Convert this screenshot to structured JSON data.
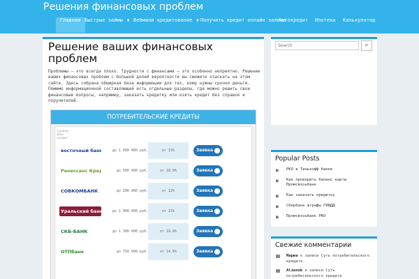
{
  "header": {
    "site_title": "Решения финансовых проблем"
  },
  "nav": {
    "items": [
      {
        "label": "Главная",
        "active": true
      },
      {
        "label": "Быстрые займы",
        "dropdown": true
      },
      {
        "label": "Вебмани кредитование",
        "dropdown": true
      },
      {
        "label": "Получить кредит онлайн заявка"
      },
      {
        "label": "Автокредит"
      },
      {
        "label": "Ипотека"
      },
      {
        "label": "Калькулятор"
      }
    ]
  },
  "main": {
    "title": "Решение ваших финансовых проблем",
    "intro": "Проблемы – это всегда плохо. Трудности с финансами – это особенно неприятно. Решение ваших финансовых проблем с большой долей вероятности вы сможете отыскать на этом сайте. Здесь собрана обширная база информации для тех, кому нужны срочно деньги. Помимо информационной составляющей есть отдельные разделы, где можно решить свои финансовые вопросы, например, заказать кредитку или взять кредит без справок и поручителей.",
    "widget": {
      "title": "ПОТРЕБИТЕЛЬСКИЕ КРЕДИТЫ",
      "logo_text": "Сравни Ваш кредит",
      "rows": [
        {
          "bank": "восточный банк",
          "color": "#1a3d7c",
          "bg": "#ffffff",
          "amount": "до 1 000 000 руб.",
          "rate": "от 15%",
          "button": "Заявка"
        },
        {
          "bank": "Ренессанс Кредит",
          "color": "#6a9a2a",
          "bg": "#ffffff",
          "amount": "до 500 000 руб.",
          "rate": "от 18.9%",
          "button": "Заявка"
        },
        {
          "bank": "СОВКОМБАНК",
          "color": "#1a3d8c",
          "bg": "#ffffff",
          "amount": "до 200 000 руб.",
          "rate": "от 12%",
          "button": "Заявка"
        },
        {
          "bank": "Уральский банк",
          "color": "#ffffff",
          "bg": "#8b1c3a",
          "amount": "до 1 000 000 руб.",
          "rate": "от 15%",
          "button": "Заявка"
        },
        {
          "bank": "СКБ-БАНК",
          "color": "#1f7a3a",
          "bg": "#ffffff",
          "amount": "до 1 300 000 руб.",
          "rate": "от 19.9%",
          "button": "Заявка"
        },
        {
          "bank": "ОТПбанк",
          "color": "#2e8b2e",
          "bg": "#ffffff",
          "amount": "до 750 000 руб.",
          "rate": "от 14.9%",
          "button": "Заявка"
        }
      ]
    }
  },
  "sidebar": {
    "search": {
      "placeholder": "Search",
      "button_icon": "search-icon"
    },
    "popular": {
      "title": "Popular Posts",
      "items": [
        "РКО в Тинькофф банке",
        "Как проверить баланс карты Промсвязьбанк",
        "Как заказать кредитку",
        "Сбербанк штрафы ГИБДД",
        "Промсвязьбанк РКО"
      ]
    },
    "comments": {
      "title": "Свежие комментарии",
      "items": [
        {
          "author": "Мария",
          "rest": " к записи Суть потребительского кредита"
        },
        {
          "author": "Alienok",
          "rest": " к записи Суть потребительского кредита"
        }
      ]
    }
  }
}
